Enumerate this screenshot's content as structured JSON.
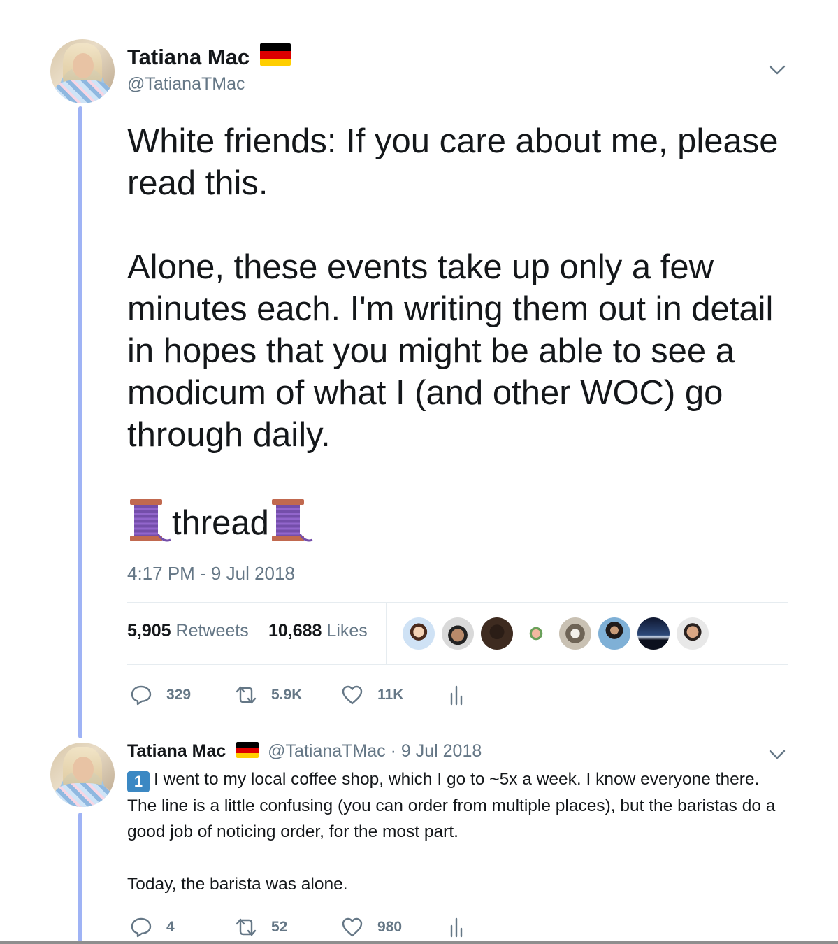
{
  "main_tweet": {
    "author_name": "Tatiana Mac",
    "author_handle": "@TatianaTMac",
    "text": "White friends: If you care about me, please read this.\n\nAlone, these events take up only a few minutes each. I'm writing them out in detail in hopes that you might be able to see a modicum of what I (and other WOC) go through daily.\n\n",
    "thread_word": "thread",
    "timestamp": "4:17 PM - 9 Jul 2018",
    "retweets_count": "5,905",
    "retweets_label": "Retweets",
    "likes_count": "10,688",
    "likes_label": "Likes",
    "actions": {
      "replies": "329",
      "retweets": "5.9K",
      "likes": "11K"
    }
  },
  "reply_tweet": {
    "author_name": "Tatiana Mac",
    "author_handle": "@TatianaTMac",
    "date_separator": "·",
    "date": "9 Jul 2018",
    "keycap": "1",
    "text": "I went to my local coffee shop, which I go to ~5x a week. I know everyone there. The line is a little confusing (you can order from multiple places), but the baristas do a good job of noticing order, for the most part.\n\nToday, the barista was alone.",
    "actions": {
      "replies": "4",
      "retweets": "52",
      "likes": "980"
    }
  },
  "colors": {
    "text": "#14171a",
    "muted": "#657786",
    "thread_line": "#9fb3f5",
    "divider": "#e6ecf0"
  },
  "icons": [
    "chevron-down-icon",
    "germany-flag-icon",
    "spool-of-thread-icon",
    "reply-icon",
    "retweet-icon",
    "like-icon",
    "analytics-icon",
    "keycap-one-icon"
  ]
}
